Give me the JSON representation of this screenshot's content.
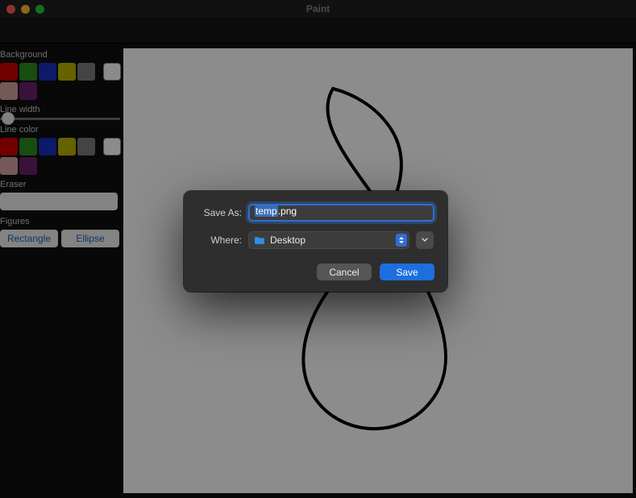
{
  "window": {
    "title": "Paint"
  },
  "sidebar": {
    "background_label": "Background",
    "line_width_label": "Line width",
    "line_color_label": "Line color",
    "eraser_label": "Eraser",
    "figures_label": "Figures",
    "figures": {
      "rectangle": "Rectangle",
      "ellipse": "Ellipse"
    },
    "swatches_row1": [
      "#cc0000",
      "#2e8b1f",
      "#1a2fbf",
      "#b8b200",
      "#7d7d7d"
    ],
    "swatches_row2": [
      "#d6a0a0",
      "#6b1f6b"
    ],
    "swatches_lc_row1": [
      "#cc0000",
      "#2e8b1f",
      "#1a2fbf",
      "#b8b200",
      "#7d7d7d"
    ],
    "swatches_lc_row2": [
      "#d6a0a0",
      "#6b1f6b"
    ],
    "selected_bg": "#ffffff",
    "selected_line": "#ffffff"
  },
  "dialog": {
    "save_as_label": "Save As:",
    "filename": "temp.png",
    "filename_selected_part": "temp",
    "filename_rest": ".png",
    "where_label": "Where:",
    "where_value": "Desktop",
    "folder_icon": "folder-icon",
    "cancel": "Cancel",
    "save": "Save"
  },
  "colors": {
    "accent": "#1d6fe0",
    "focus_ring": "#2f6fd0"
  }
}
